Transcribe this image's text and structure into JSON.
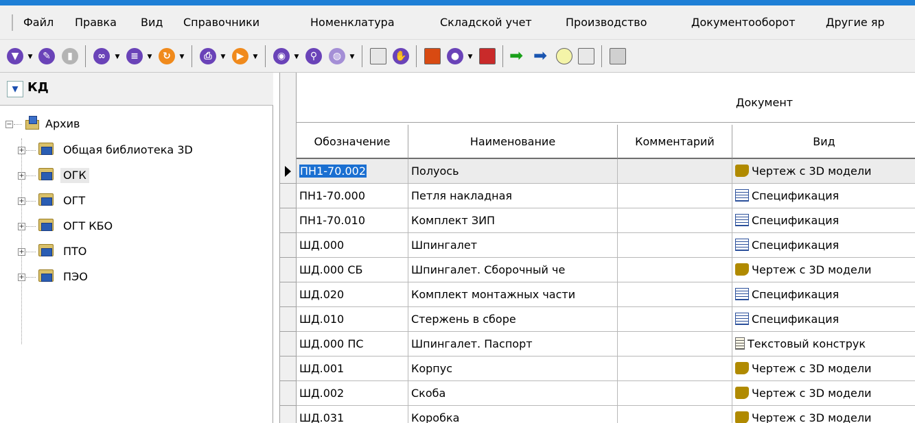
{
  "menu": [
    "Файл",
    "Правка",
    "Вид",
    "Справочники",
    "Номенклатура",
    "Складской учет",
    "Производство",
    "Документооборот",
    "Другие яр"
  ],
  "left_panel": {
    "title": "КД",
    "tree": [
      {
        "label": "Архив",
        "level": 0,
        "expanded": true
      },
      {
        "label": "Общая библиотека 3D",
        "level": 1
      },
      {
        "label": "ОГК",
        "level": 1,
        "selected": true
      },
      {
        "label": "ОГТ",
        "level": 1
      },
      {
        "label": "ОГТ КБО",
        "level": 1
      },
      {
        "label": "ПТО",
        "level": 1
      },
      {
        "label": "ПЭО",
        "level": 1
      }
    ]
  },
  "grid": {
    "group_header": "Документ",
    "columns": [
      "Обозначение",
      "Наименование",
      "Комментарий",
      "Вид"
    ],
    "rows": [
      {
        "designation": "ПН1-70.002",
        "name": "Полуось",
        "comment": "",
        "kind": "Чертеж с 3D модели",
        "icon": "drawing-3d-icon"
      },
      {
        "designation": "ПН1-70.000",
        "name": "Петля накладная",
        "comment": "",
        "kind": "Спецификация",
        "icon": "specification-icon"
      },
      {
        "designation": "ПН1-70.010",
        "name": "Комплект ЗИП",
        "comment": "",
        "kind": "Спецификация",
        "icon": "specification-icon"
      },
      {
        "designation": "ШД.000",
        "name": "Шпингалет",
        "comment": "",
        "kind": "Спецификация",
        "icon": "specification-icon"
      },
      {
        "designation": "ШД.000 СБ",
        "name": "Шпингалет. Сборочный че",
        "comment": "",
        "kind": "Чертеж с 3D модели",
        "icon": "drawing-3d-icon"
      },
      {
        "designation": "ШД.020",
        "name": "Комплект монтажных части",
        "comment": "",
        "kind": "Спецификация",
        "icon": "specification-icon"
      },
      {
        "designation": "ШД.010",
        "name": "Стержень в сборе",
        "comment": "",
        "kind": "Спецификация",
        "icon": "specification-icon"
      },
      {
        "designation": "ШД.000 ПС",
        "name": "Шпингалет. Паспорт",
        "comment": "",
        "kind": "Текстовый конструк",
        "icon": "text-document-icon"
      },
      {
        "designation": "ШД.001",
        "name": "Корпус",
        "comment": "",
        "kind": "Чертеж с 3D модели",
        "icon": "drawing-3d-icon"
      },
      {
        "designation": "ШД.002",
        "name": "Скоба",
        "comment": "",
        "kind": "Чертеж с 3D модели",
        "icon": "drawing-3d-icon"
      },
      {
        "designation": "ШД.031",
        "name": "Коробка",
        "comment": "",
        "kind": "Чертеж с 3D модели",
        "icon": "drawing-3d-icon"
      }
    ]
  },
  "colors": {
    "accent": "#1e7fd6",
    "selection": "#1a6fd1",
    "folder": "#d9c06a"
  }
}
